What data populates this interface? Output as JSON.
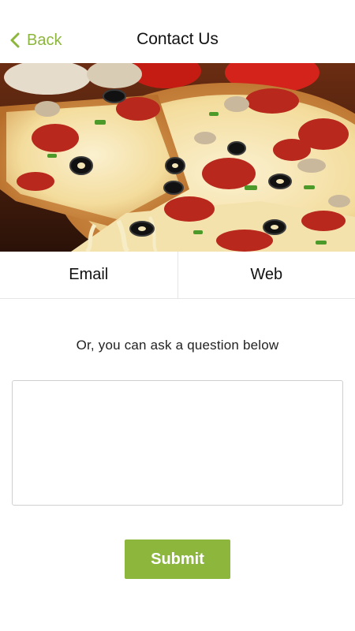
{
  "colors": {
    "accent": "#8db63c",
    "text": "#111111",
    "border": "#e6e6e6"
  },
  "header": {
    "back_icon": "chevron-left-icon",
    "back_label": "Back",
    "title": "Contact Us"
  },
  "hero": {
    "image": "pizza-photo"
  },
  "tabs": [
    {
      "label": "Email"
    },
    {
      "label": "Web"
    }
  ],
  "form": {
    "prompt": "Or, you can ask a question below",
    "question_value": "",
    "question_placeholder": "",
    "submit_label": "Submit"
  }
}
